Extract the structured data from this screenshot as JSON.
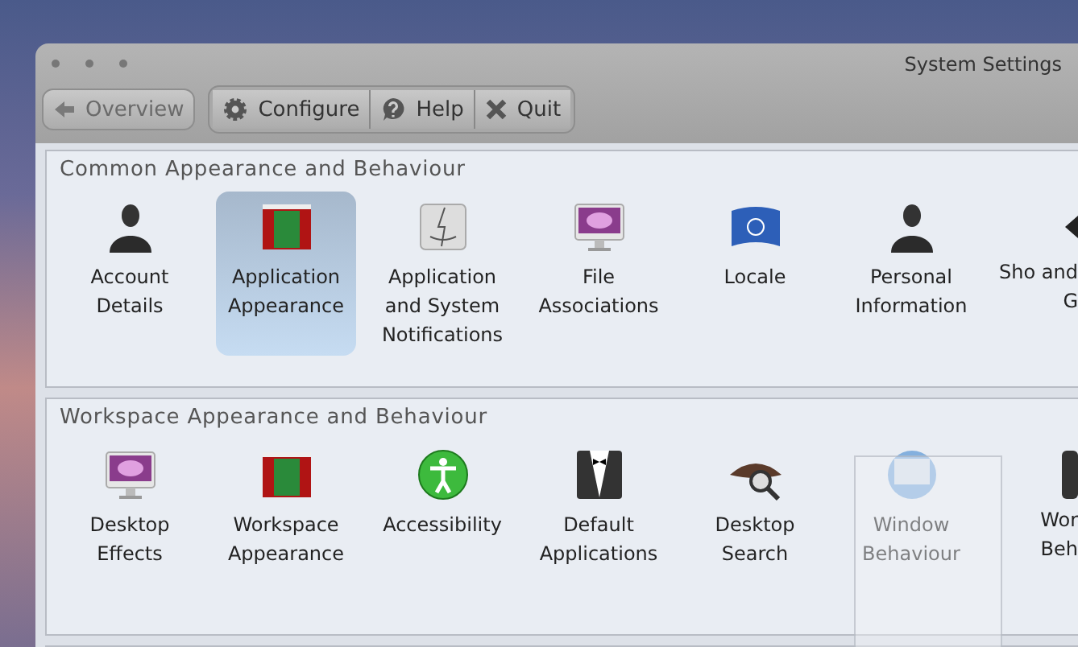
{
  "window": {
    "title": "System Settings"
  },
  "toolbar": {
    "back": {
      "label": "Overview",
      "disabled": true
    },
    "buttons": [
      {
        "label": "Configure"
      },
      {
        "label": "Help"
      },
      {
        "label": "Quit"
      }
    ]
  },
  "sections": [
    {
      "title": "Common Appearance and Behaviour",
      "items": [
        {
          "label": "Account Details",
          "selected": false
        },
        {
          "label": "Application Appearance",
          "selected": true
        },
        {
          "label": "Application and System Notifications",
          "selected": false
        },
        {
          "label": "File Associations",
          "selected": false
        },
        {
          "label": "Locale",
          "selected": false
        },
        {
          "label": "Personal Information",
          "selected": false
        },
        {
          "label": "Sho and G",
          "selected": false
        }
      ]
    },
    {
      "title": "Workspace Appearance and Behaviour",
      "items": [
        {
          "label": "Desktop Effects",
          "selected": false
        },
        {
          "label": "Workspace Appearance",
          "selected": false
        },
        {
          "label": "Accessibility",
          "selected": false
        },
        {
          "label": "Default Applications",
          "selected": false
        },
        {
          "label": "Desktop Search",
          "selected": false
        },
        {
          "label": "Window Behaviour",
          "selected": false
        },
        {
          "label": "Wor Beh",
          "selected": false
        }
      ]
    }
  ]
}
